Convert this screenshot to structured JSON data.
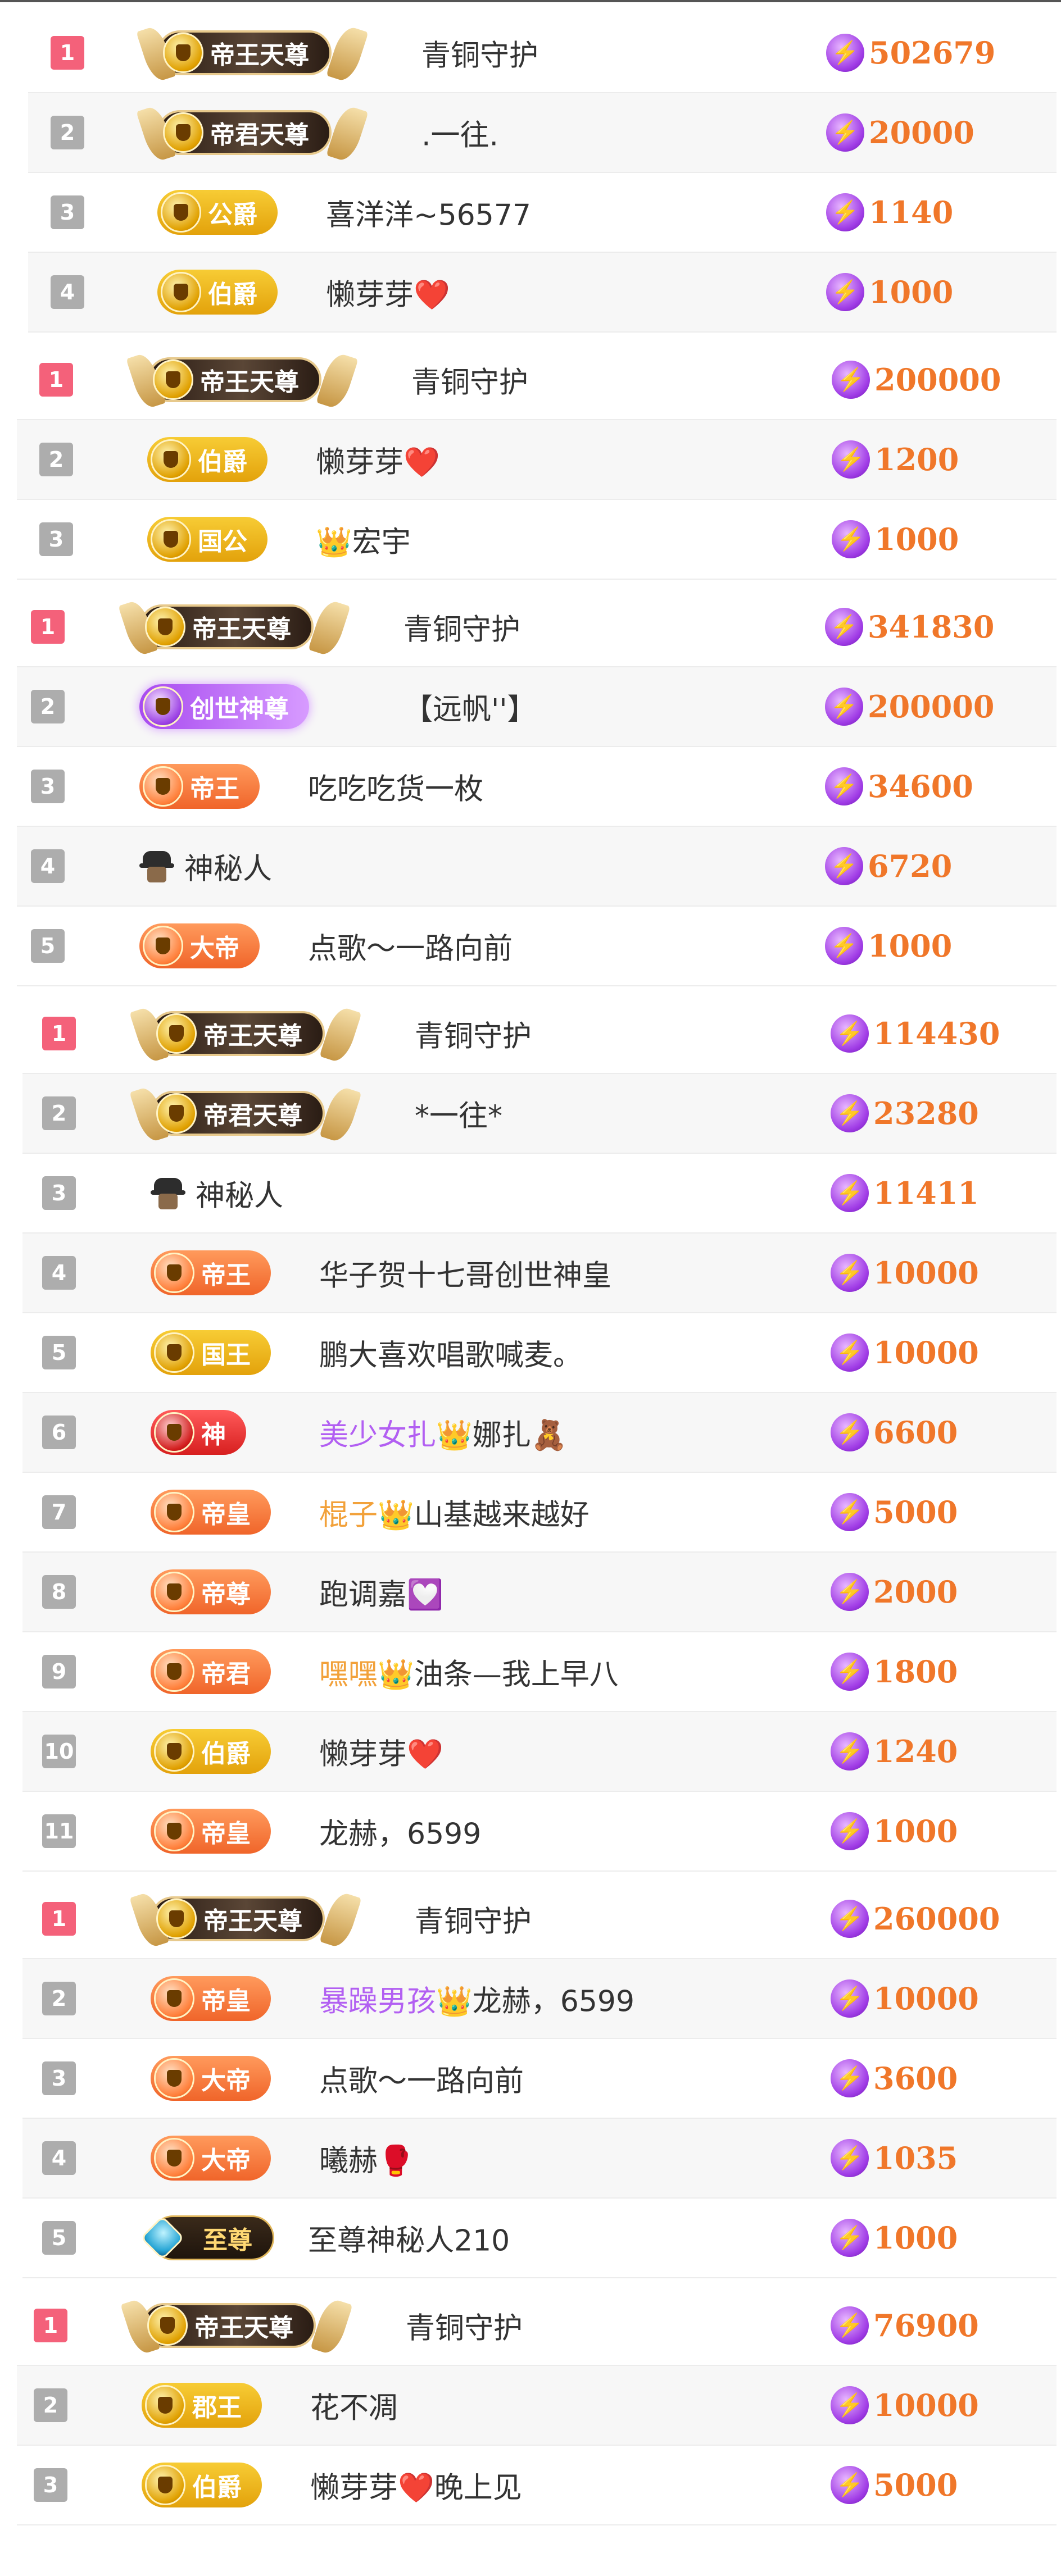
{
  "colors": {
    "rank_first": "#f4617a",
    "rank_other": "#adadad",
    "score_text": "#f0772a",
    "coin": "#a03ce6",
    "name_text": "#333333",
    "purple_name": "#b25ff2",
    "orange_name": "#f2a13a"
  },
  "leaderboards": [
    {
      "entries": [
        {
          "rank": "1",
          "badge": "帝王天尊",
          "badge_tier": "emperor-supreme",
          "name": "青铜守护",
          "score": "502679"
        },
        {
          "rank": "2",
          "badge": "帝君天尊",
          "badge_tier": "emperor-lord",
          "name": ".一往.",
          "score": "20000"
        },
        {
          "rank": "3",
          "badge": "公爵",
          "badge_tier": "gold",
          "name": "喜洋洋~56577",
          "score": "1140"
        },
        {
          "rank": "4",
          "badge": "伯爵",
          "badge_tier": "gold",
          "name": "懒芽芽",
          "name_emoji": "❤️",
          "score": "1000"
        }
      ]
    },
    {
      "entries": [
        {
          "rank": "1",
          "badge": "帝王天尊",
          "badge_tier": "emperor-supreme",
          "name": "青铜守护",
          "score": "200000"
        },
        {
          "rank": "2",
          "badge": "伯爵",
          "badge_tier": "gold",
          "name": "懒芽芽",
          "name_emoji": "❤️",
          "score": "1200"
        },
        {
          "rank": "3",
          "badge": "国公",
          "badge_tier": "gold",
          "name_emoji_prefix": "👑",
          "name": "宏宇",
          "score": "1000"
        }
      ]
    },
    {
      "entries": [
        {
          "rank": "1",
          "badge": "帝王天尊",
          "badge_tier": "emperor-supreme",
          "name": "青铜守护",
          "score": "341830"
        },
        {
          "rank": "2",
          "badge": "创世神尊",
          "badge_tier": "purple",
          "name": "【远帆''】",
          "score": "200000"
        },
        {
          "rank": "3",
          "badge": "帝王",
          "badge_tier": "orange",
          "name": "吃吃吃货一枚",
          "score": "34600"
        },
        {
          "rank": "4",
          "badge": "",
          "badge_tier": "mystery",
          "name": "神秘人",
          "score": "6720"
        },
        {
          "rank": "5",
          "badge": "大帝",
          "badge_tier": "orange",
          "name": "点歌～一路向前",
          "score": "1000"
        }
      ]
    },
    {
      "entries": [
        {
          "rank": "1",
          "badge": "帝王天尊",
          "badge_tier": "emperor-supreme",
          "name": "青铜守护",
          "score": "114430"
        },
        {
          "rank": "2",
          "badge": "帝君天尊",
          "badge_tier": "emperor-lord",
          "name": "*一往*",
          "score": "23280"
        },
        {
          "rank": "3",
          "badge": "",
          "badge_tier": "mystery",
          "name": "神秘人",
          "score": "11411"
        },
        {
          "rank": "4",
          "badge": "帝王",
          "badge_tier": "orange",
          "name": "华子贺十七哥创世神皇",
          "score": "10000"
        },
        {
          "rank": "5",
          "badge": "国王",
          "badge_tier": "gold",
          "name": "鹏大喜欢唱歌喊麦。",
          "score": "10000"
        },
        {
          "rank": "6",
          "badge": "神",
          "badge_tier": "red",
          "name_colored": "美少女扎",
          "name_colored_style": "purple",
          "name_emoji_mid": "👑",
          "name": "娜扎",
          "name_emoji": "🧸",
          "score": "6600"
        },
        {
          "rank": "7",
          "badge": "帝皇",
          "badge_tier": "orange",
          "name_colored": "棍子",
          "name_colored_style": "orange",
          "name_emoji_mid": "👑",
          "name": "山基越来越好",
          "score": "5000"
        },
        {
          "rank": "8",
          "badge": "帝尊",
          "badge_tier": "orange",
          "name": "跑调嘉",
          "name_emoji": "💟",
          "score": "2000"
        },
        {
          "rank": "9",
          "badge": "帝君",
          "badge_tier": "orange",
          "name_colored": "嘿嘿",
          "name_colored_style": "orange",
          "name_emoji_mid": "👑",
          "name": "油条—我上早八",
          "score": "1800"
        },
        {
          "rank": "10",
          "badge": "伯爵",
          "badge_tier": "gold",
          "name": "懒芽芽",
          "name_emoji": "❤️",
          "score": "1240"
        },
        {
          "rank": "11",
          "badge": "帝皇",
          "badge_tier": "orange",
          "name": "龙赫，6599",
          "score": "1000"
        }
      ]
    },
    {
      "entries": [
        {
          "rank": "1",
          "badge": "帝王天尊",
          "badge_tier": "emperor-supreme",
          "name": "青铜守护",
          "score": "260000"
        },
        {
          "rank": "2",
          "badge": "帝皇",
          "badge_tier": "orange",
          "name_colored": "暴躁男孩",
          "name_colored_style": "purple",
          "name_emoji_mid": "👑",
          "name": "龙赫，6599",
          "score": "10000"
        },
        {
          "rank": "3",
          "badge": "大帝",
          "badge_tier": "orange",
          "name": "点歌～一路向前",
          "score": "3600"
        },
        {
          "rank": "4",
          "badge": "大帝",
          "badge_tier": "orange",
          "name": "曦赫",
          "name_emoji": "🥊",
          "score": "1035"
        },
        {
          "rank": "5",
          "badge": "至尊",
          "badge_tier": "black",
          "name": "至尊神秘人210",
          "score": "1000"
        }
      ]
    },
    {
      "entries": [
        {
          "rank": "1",
          "badge": "帝王天尊",
          "badge_tier": "emperor-supreme",
          "name": "青铜守护",
          "score": "76900"
        },
        {
          "rank": "2",
          "badge": "郡王",
          "badge_tier": "gold",
          "name": "花不凋",
          "score": "10000"
        },
        {
          "rank": "3",
          "badge": "伯爵",
          "badge_tier": "gold",
          "name": "懒芽芽",
          "name_emoji": "❤️",
          "name_suffix": "晚上见",
          "score": "5000"
        }
      ]
    }
  ]
}
